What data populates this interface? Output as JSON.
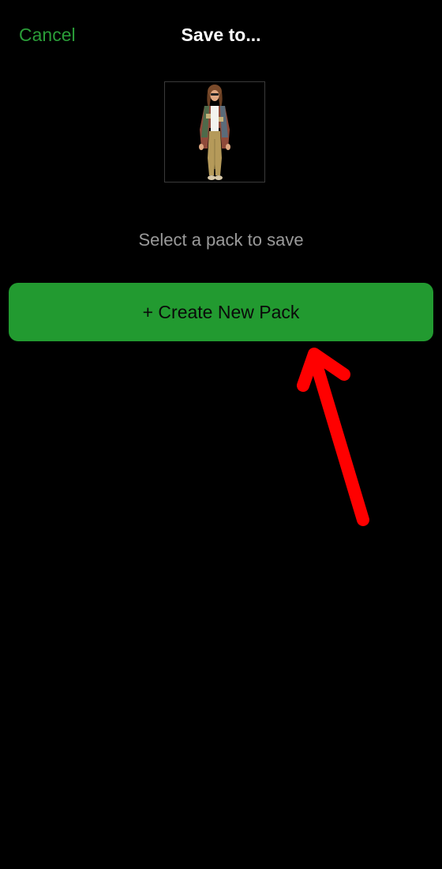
{
  "nav": {
    "cancel_label": "Cancel",
    "title": "Save to..."
  },
  "sticker": {
    "icon": "person-sticker-image"
  },
  "prompt": "Select a pack to save",
  "create_button_label": "+ Create New Pack",
  "annotation": {
    "icon": "red-arrow-icon"
  },
  "colors": {
    "background": "#000000",
    "accent_green": "#2a9d38",
    "button_green": "#229a30",
    "prompt_gray": "#9a9a9a",
    "arrow_red": "#ff0000"
  }
}
